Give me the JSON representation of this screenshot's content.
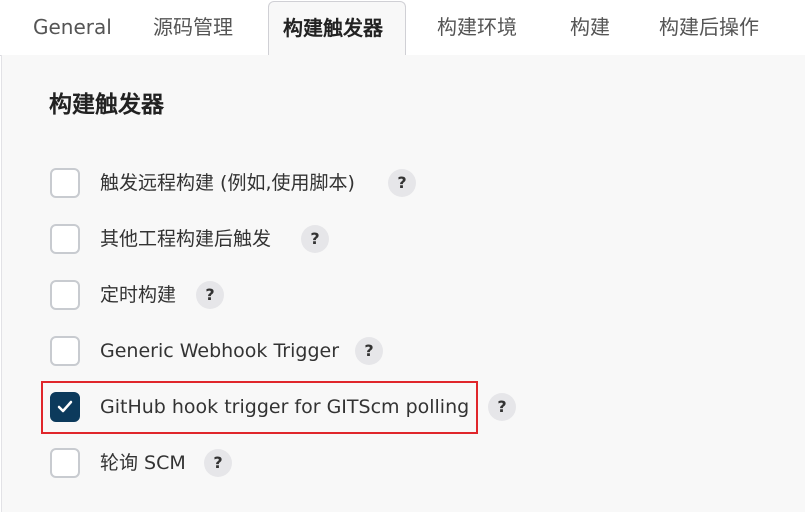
{
  "tabs": [
    {
      "label": "General"
    },
    {
      "label": "源码管理"
    },
    {
      "label": "构建触发器"
    },
    {
      "label": "构建环境"
    },
    {
      "label": "构建"
    },
    {
      "label": "构建后操作"
    }
  ],
  "section_title": "构建触发器",
  "triggers": [
    {
      "label": "触发远程构建 (例如,使用脚本)",
      "checked": false,
      "help": "?"
    },
    {
      "label": "其他工程构建后触发",
      "checked": false,
      "help": "?"
    },
    {
      "label": "定时构建",
      "checked": false,
      "help": "?"
    },
    {
      "label": "Generic Webhook Trigger",
      "checked": false,
      "help": "?"
    },
    {
      "label": "GitHub hook trigger for GITScm polling",
      "checked": true,
      "help": "?"
    },
    {
      "label": "轮询 SCM",
      "checked": false,
      "help": "?"
    }
  ],
  "colors": {
    "accent": "#0c3a5c",
    "highlight_border": "#e0262b"
  }
}
